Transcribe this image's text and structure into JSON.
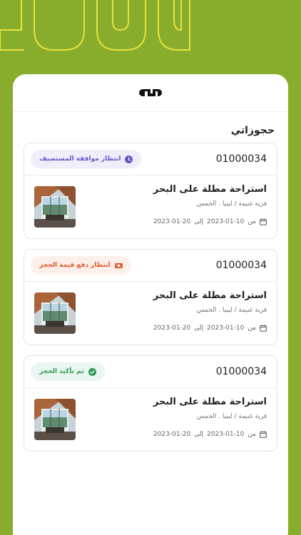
{
  "app": {
    "logo_text": "دار"
  },
  "page": {
    "title": "حجوزاتي"
  },
  "bookings": [
    {
      "code": "01000034",
      "status_label": "انتظار موافقة المستضيف",
      "status_icon": "clock-icon",
      "status_color": "#6b55c8",
      "property_title": "استراحة مطلة على البحر",
      "location": "قرية غنيمة / ليبيا . الخمس",
      "date_from_label": "من",
      "date_from": "2023-01-10",
      "date_to_label": "إلى",
      "date_to": "2023-01-20"
    },
    {
      "code": "01000034",
      "status_label": "انتظار دفع قيمة الحجز",
      "status_icon": "payment-icon",
      "status_color": "#e2572b",
      "property_title": "استراحة مطلة على البحر",
      "location": "قرية غنيمة / ليبيا . الخمس",
      "date_from_label": "من",
      "date_from": "2023-01-10",
      "date_to_label": "إلى",
      "date_to": "2023-01-20"
    },
    {
      "code": "01000034",
      "status_label": "تم تأكيد الحجز",
      "status_icon": "check-circle-icon",
      "status_color": "#2e9b59",
      "property_title": "استراحة مطلة على البحر",
      "location": "قرية غنيمة / ليبيا . الخمس",
      "date_from_label": "من",
      "date_from": "2023-01-10",
      "date_to_label": "إلى",
      "date_to": "2023-01-20"
    }
  ],
  "colors": {
    "background": "#88ad2c",
    "hero_stroke": "#e8e23a"
  }
}
